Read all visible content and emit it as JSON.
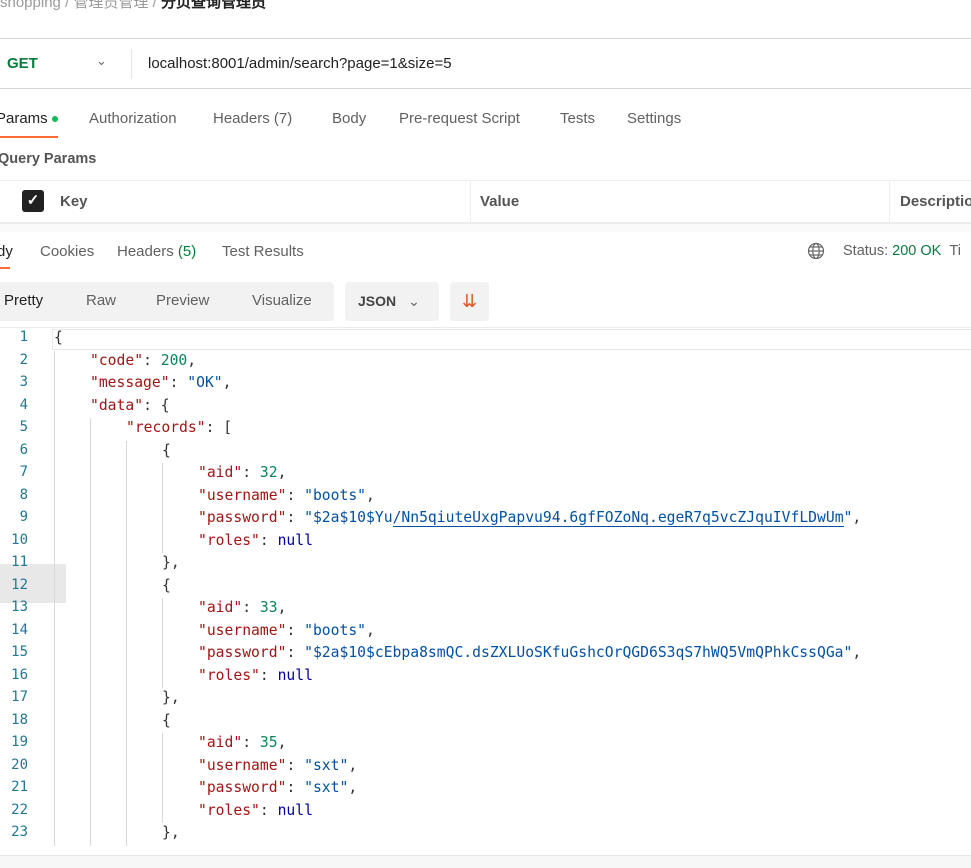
{
  "breadcrumb": {
    "items": [
      "shopping",
      "管理员管理",
      "分页查询管理员"
    ],
    "separator": "/"
  },
  "request": {
    "method": "GET",
    "url": "localhost:8001/admin/search?page=1&size=5"
  },
  "request_tabs": [
    {
      "label": "Params",
      "active": true
    },
    {
      "label": "Authorization"
    },
    {
      "label": "Headers (7)"
    },
    {
      "label": "Body"
    },
    {
      "label": "Pre-request Script"
    },
    {
      "label": "Tests"
    },
    {
      "label": "Settings"
    }
  ],
  "query_params": {
    "title": "Query Params",
    "columns": [
      "Key",
      "Value",
      "Descriptio"
    ]
  },
  "response_tabs": {
    "body": "dy",
    "cookies": "Cookies",
    "headers": "Headers",
    "headers_count": "(5)",
    "tests": "Test Results"
  },
  "status": {
    "label": "Status:",
    "value": "200 OK",
    "extra": "Ti",
    "color": "#0b7a3e"
  },
  "view_modes": [
    "Pretty",
    "Raw",
    "Preview",
    "Visualize"
  ],
  "format": "JSON",
  "accent": "#ff6c37",
  "code_lines": [
    {
      "i": 0,
      "t": [
        [
          "p",
          "{"
        ]
      ]
    },
    {
      "i": 1,
      "t": [
        [
          "k",
          "\"code\""
        ],
        [
          "p",
          ": "
        ],
        [
          "n",
          "200"
        ],
        [
          "p",
          ","
        ]
      ]
    },
    {
      "i": 1,
      "t": [
        [
          "k",
          "\"message\""
        ],
        [
          "p",
          ": "
        ],
        [
          "s",
          "\"OK\""
        ],
        [
          "p",
          ","
        ]
      ]
    },
    {
      "i": 1,
      "t": [
        [
          "k",
          "\"data\""
        ],
        [
          "p",
          ": {"
        ]
      ]
    },
    {
      "i": 2,
      "t": [
        [
          "k",
          "\"records\""
        ],
        [
          "p",
          ": ["
        ]
      ]
    },
    {
      "i": 3,
      "t": [
        [
          "p",
          "{"
        ]
      ]
    },
    {
      "i": 4,
      "t": [
        [
          "k",
          "\"aid\""
        ],
        [
          "p",
          ": "
        ],
        [
          "n",
          "32"
        ],
        [
          "p",
          ","
        ]
      ]
    },
    {
      "i": 4,
      "t": [
        [
          "k",
          "\"username\""
        ],
        [
          "p",
          ": "
        ],
        [
          "s",
          "\"boots\""
        ],
        [
          "p",
          ","
        ]
      ]
    },
    {
      "i": 4,
      "t": [
        [
          "k",
          "\"password\""
        ],
        [
          "p",
          ": "
        ],
        [
          "s",
          "\"$2a$10$Yu"
        ],
        [
          "su",
          "/Nn5qiuteUxgPapvu94.6gfFOZoNq.egeR7q5vcZJquIVfLDwUm"
        ],
        [
          "s",
          "\""
        ],
        [
          "p",
          ","
        ]
      ]
    },
    {
      "i": 4,
      "t": [
        [
          "k",
          "\"roles\""
        ],
        [
          "p",
          ": "
        ],
        [
          "nl",
          "null"
        ]
      ]
    },
    {
      "i": 3,
      "t": [
        [
          "p",
          "},"
        ]
      ]
    },
    {
      "i": 3,
      "t": [
        [
          "p",
          "{"
        ]
      ]
    },
    {
      "i": 4,
      "t": [
        [
          "k",
          "\"aid\""
        ],
        [
          "p",
          ": "
        ],
        [
          "n",
          "33"
        ],
        [
          "p",
          ","
        ]
      ]
    },
    {
      "i": 4,
      "t": [
        [
          "k",
          "\"username\""
        ],
        [
          "p",
          ": "
        ],
        [
          "s",
          "\"boots\""
        ],
        [
          "p",
          ","
        ]
      ]
    },
    {
      "i": 4,
      "t": [
        [
          "k",
          "\"password\""
        ],
        [
          "p",
          ": "
        ],
        [
          "s",
          "\"$2a$10$cEbpa8smQC.dsZXLUoSKfuGshcOrQGD6S3qS7hWQ5VmQPhkCssQGa\""
        ],
        [
          "p",
          ","
        ]
      ]
    },
    {
      "i": 4,
      "t": [
        [
          "k",
          "\"roles\""
        ],
        [
          "p",
          ": "
        ],
        [
          "nl",
          "null"
        ]
      ]
    },
    {
      "i": 3,
      "t": [
        [
          "p",
          "},"
        ]
      ]
    },
    {
      "i": 3,
      "t": [
        [
          "p",
          "{"
        ]
      ]
    },
    {
      "i": 4,
      "t": [
        [
          "k",
          "\"aid\""
        ],
        [
          "p",
          ": "
        ],
        [
          "n",
          "35"
        ],
        [
          "p",
          ","
        ]
      ]
    },
    {
      "i": 4,
      "t": [
        [
          "k",
          "\"username\""
        ],
        [
          "p",
          ": "
        ],
        [
          "s",
          "\"sxt\""
        ],
        [
          "p",
          ","
        ]
      ]
    },
    {
      "i": 4,
      "t": [
        [
          "k",
          "\"password\""
        ],
        [
          "p",
          ": "
        ],
        [
          "s",
          "\"sxt\""
        ],
        [
          "p",
          ","
        ]
      ]
    },
    {
      "i": 4,
      "t": [
        [
          "k",
          "\"roles\""
        ],
        [
          "p",
          ": "
        ],
        [
          "nl",
          "null"
        ]
      ]
    },
    {
      "i": 3,
      "t": [
        [
          "p",
          "},"
        ]
      ]
    }
  ]
}
